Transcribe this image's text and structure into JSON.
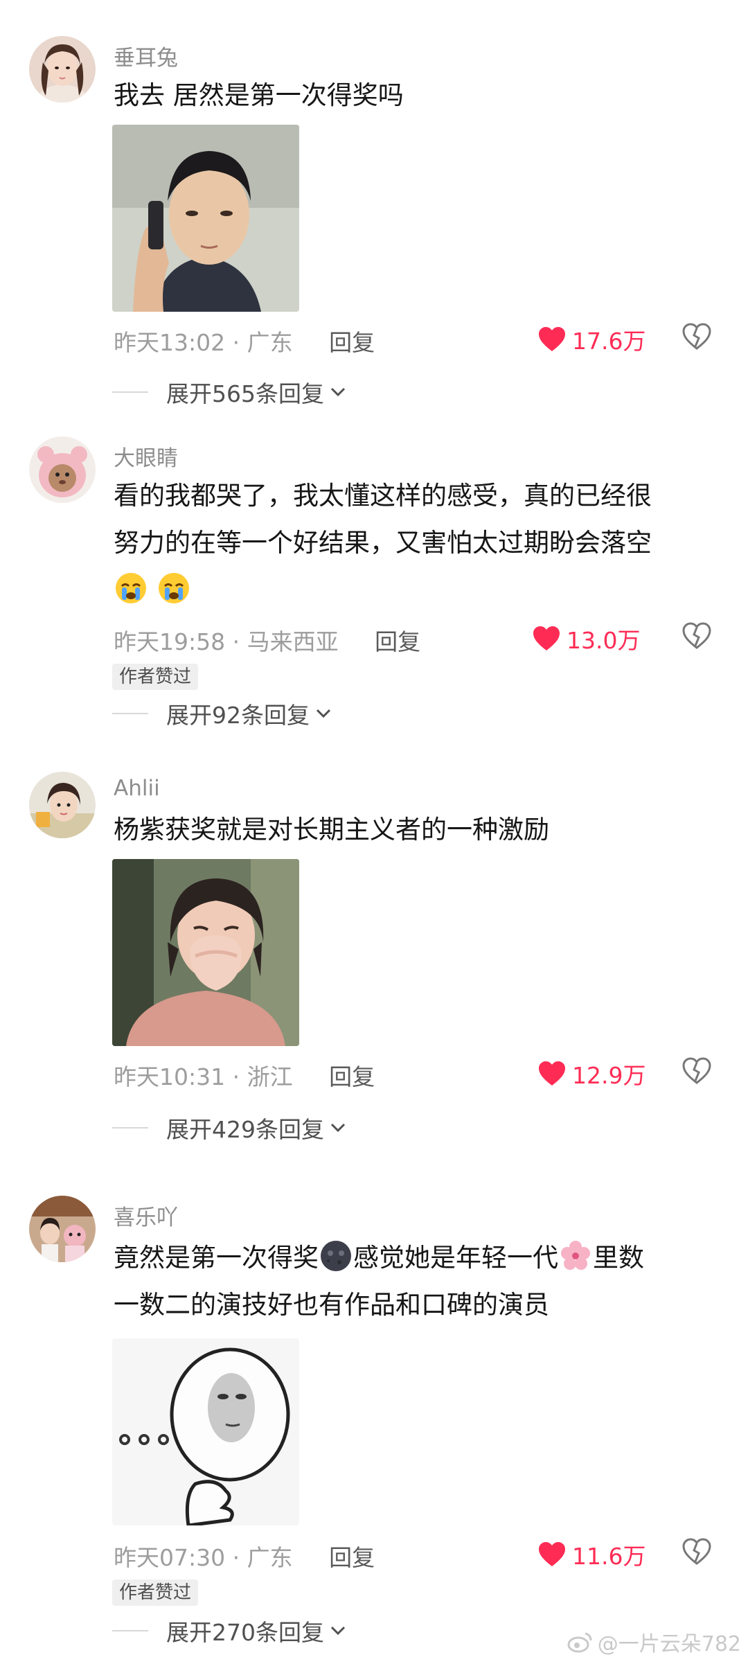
{
  "comments": [
    {
      "username": "垂耳兔",
      "text": "我去 居然是第一次得奖吗",
      "time": "昨天13:02",
      "location": "广东",
      "reply_label": "回复",
      "likes": "17.6万",
      "expand_label": "展开565条回复"
    },
    {
      "username": "大眼睛",
      "text_line1": "看的我都哭了，我太懂这样的感受，真的已经很",
      "text_line2": "努力的在等一个好结果，又害怕太过期盼会落空",
      "emojis": [
        "crying-face-emoji",
        "crying-face-emoji"
      ],
      "time": "昨天19:58",
      "location": "马来西亚",
      "reply_label": "回复",
      "likes": "13.0万",
      "badge": "作者赞过",
      "expand_label": "展开92条回复"
    },
    {
      "username": "Ahlii",
      "text": "杨紫获奖就是对长期主义者的一种激励",
      "time": "昨天10:31",
      "location": "浙江",
      "reply_label": "回复",
      "likes": "12.9万",
      "expand_label": "展开429条回复"
    },
    {
      "username": "喜乐吖",
      "text_line1_a": "竟然是第一次得奖",
      "text_line1_b": "感觉她是年轻一代",
      "text_line1_c": "里数",
      "text_line2": "一数二的演技好也有作品和口碑的演员",
      "time": "昨天07:30",
      "location": "广东",
      "reply_label": "回复",
      "likes": "11.6万",
      "badge": "作者赞过",
      "expand_label": "展开270条回复"
    }
  ],
  "separator": "·",
  "watermark": "@一片云朵782",
  "colors": {
    "like": "#fe2c55",
    "meta": "#9d9d9d",
    "username": "#8d8d8d"
  }
}
